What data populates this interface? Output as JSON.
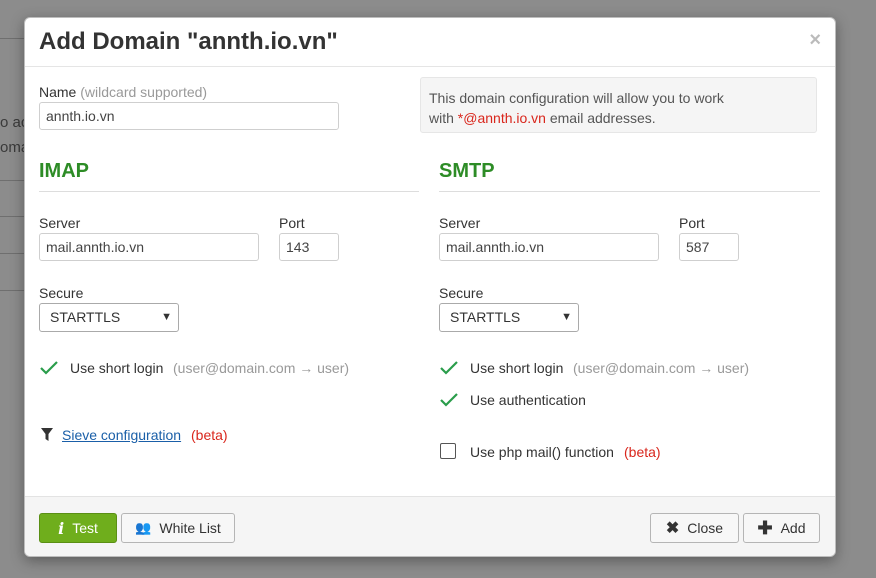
{
  "background": {
    "fragments": [
      "o ac",
      "oma"
    ]
  },
  "modal": {
    "title": "Add Domain \"annth.io.vn\"",
    "close_glyph": "×"
  },
  "name_field": {
    "label": "Name",
    "hint": "(wildcard supported)",
    "value": "annth.io.vn"
  },
  "info": {
    "line1": "This domain configuration will allow you to work",
    "line2_prefix": "with ",
    "line2_highlight": "*@annth.io.vn",
    "line2_suffix": " email addresses."
  },
  "imap": {
    "title": "IMAP",
    "server_label": "Server",
    "server_value": "mail.annth.io.vn",
    "port_label": "Port",
    "port_value": "143",
    "secure_label": "Secure",
    "secure_value": "STARTTLS",
    "short_login_label": "Use short login",
    "short_login_hint": "(user@domain.com → user)",
    "short_login_checked": true,
    "sieve_link": "Sieve configuration",
    "sieve_beta": "(beta)"
  },
  "smtp": {
    "title": "SMTP",
    "server_label": "Server",
    "server_value": "mail.annth.io.vn",
    "port_label": "Port",
    "port_value": "587",
    "secure_label": "Secure",
    "secure_value": "STARTTLS",
    "short_login_label": "Use short login",
    "short_login_hint": "(user@domain.com → user)",
    "short_login_checked": true,
    "auth_label": "Use authentication",
    "auth_checked": true,
    "php_mail_label": "Use php mail() function",
    "php_mail_beta": "(beta)",
    "php_mail_checked": false
  },
  "footer": {
    "test_label": "Test",
    "whitelist_label": "White List",
    "close_label": "Close",
    "add_label": "Add"
  },
  "colors": {
    "section_green": "#2d8c26",
    "beta_red": "#d9261c",
    "test_button": "#6fae1c"
  }
}
